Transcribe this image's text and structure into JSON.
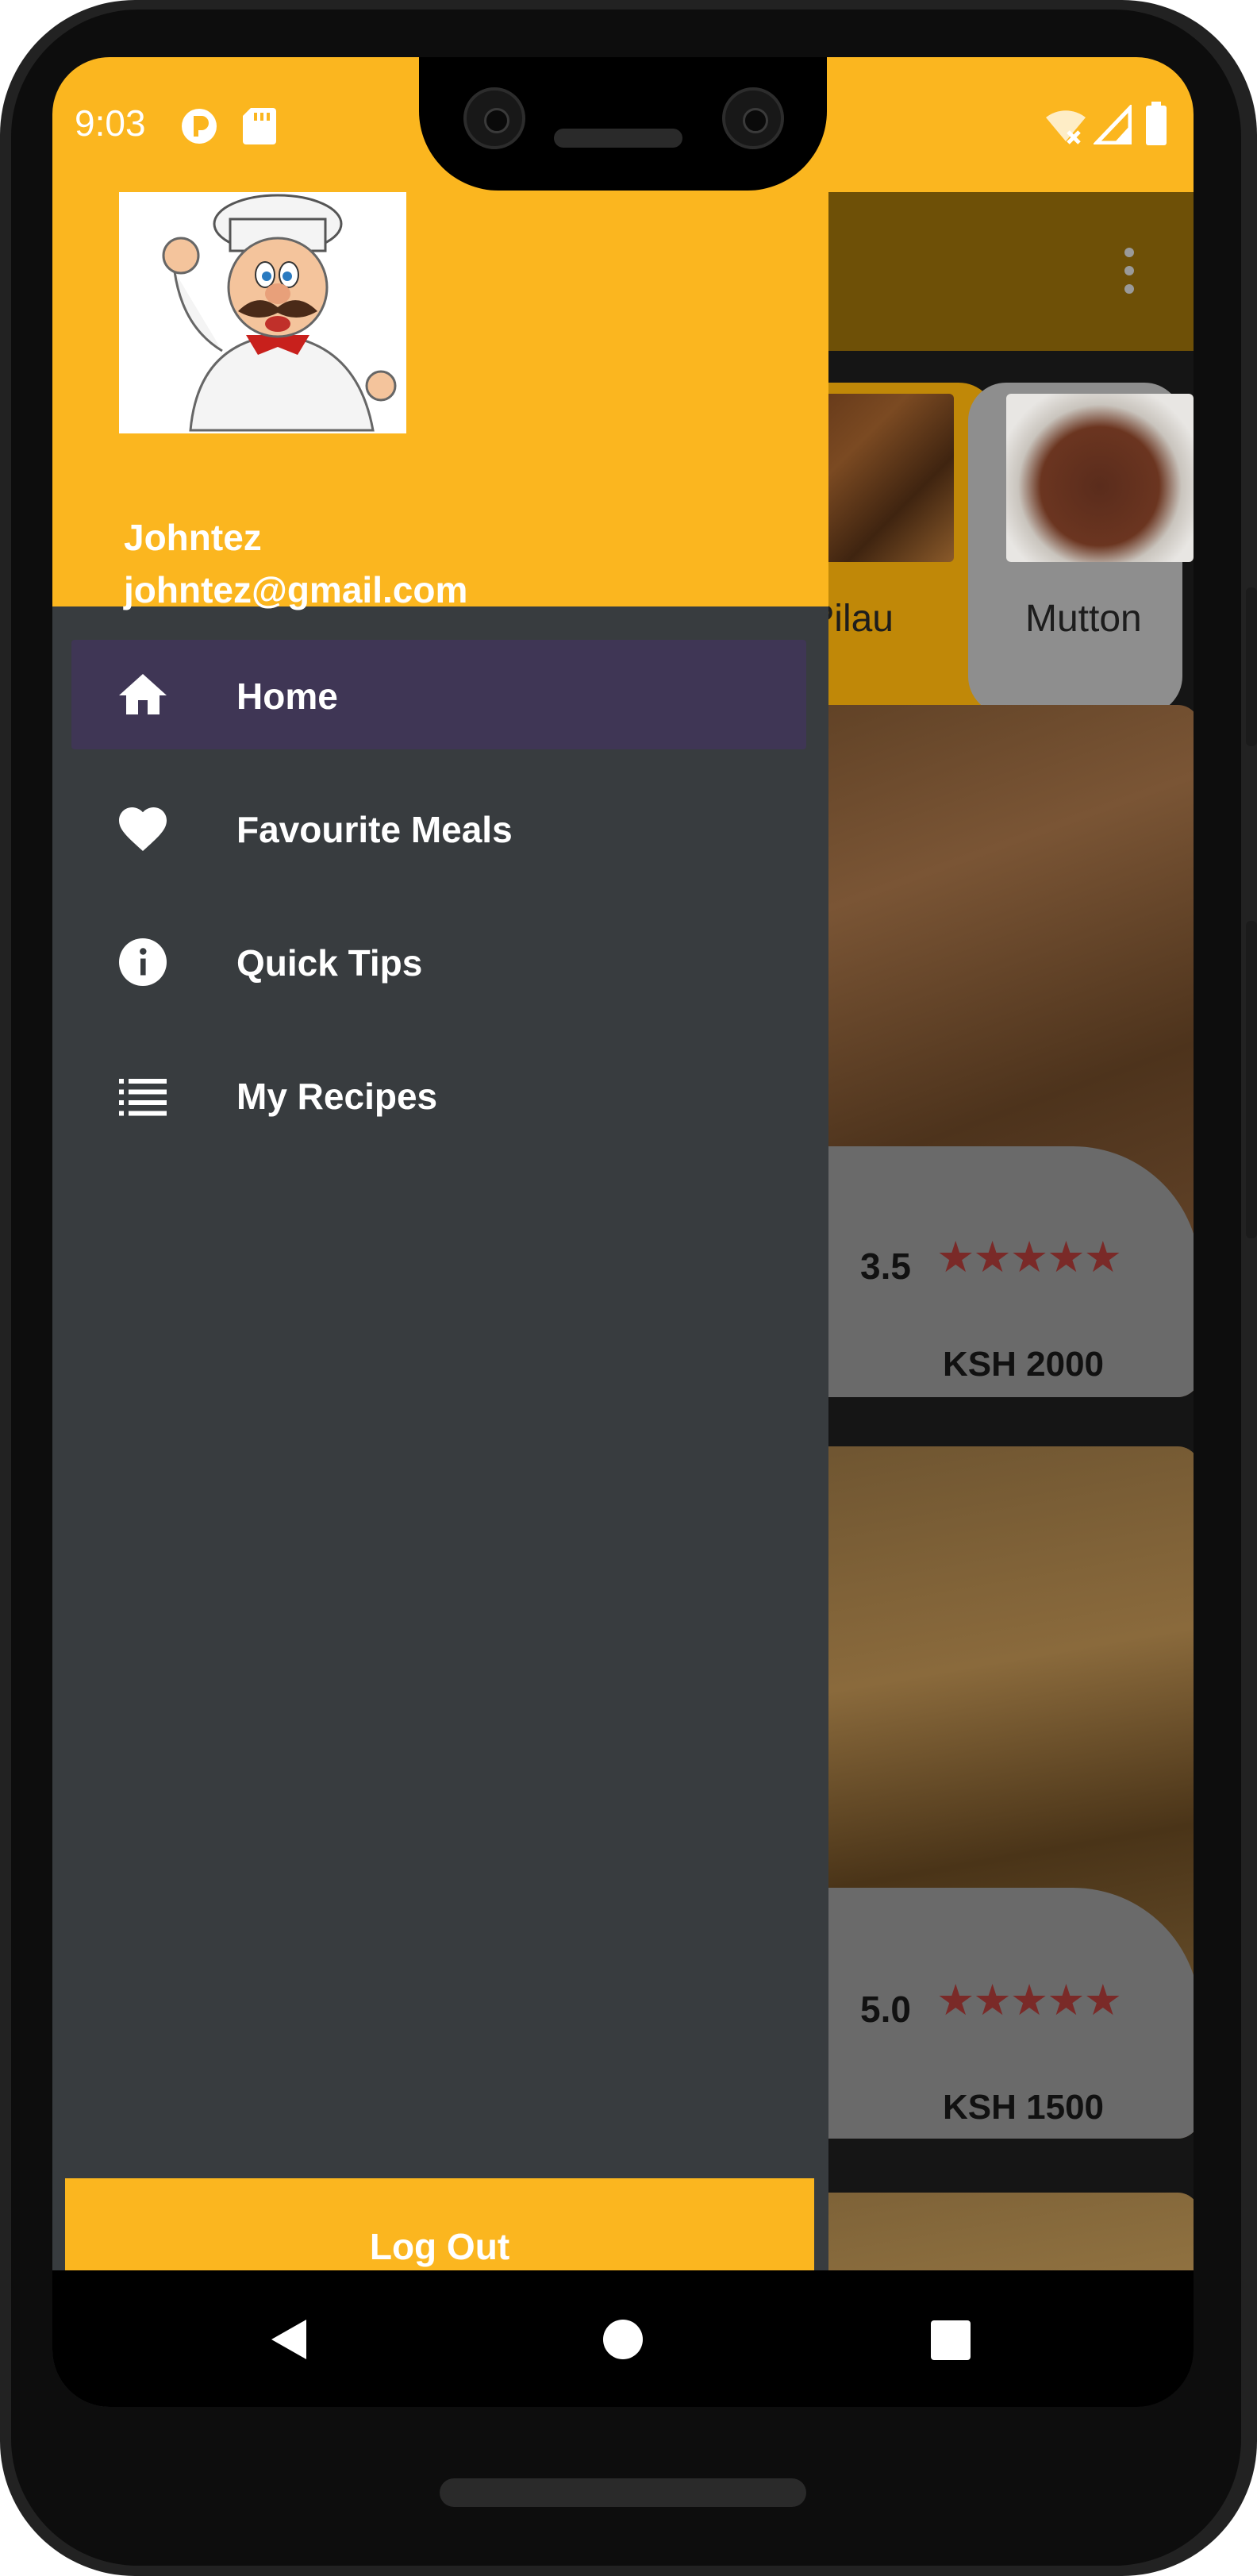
{
  "status_bar": {
    "time": "9:03"
  },
  "background": {
    "categories": [
      {
        "label": "Pilau"
      },
      {
        "label": "Mutton"
      }
    ],
    "meals": [
      {
        "rating": "3.5",
        "stars": "★★★★★",
        "price": "KSH 2000"
      },
      {
        "rating": "5.0",
        "stars": "★★★★★",
        "price": "KSH 1500"
      }
    ]
  },
  "drawer": {
    "user": {
      "name": "Johntez",
      "email": "johntez@gmail.com"
    },
    "items": [
      {
        "label": "Home",
        "icon": "home-icon",
        "active": true
      },
      {
        "label": "Favourite Meals",
        "icon": "heart-icon",
        "active": false
      },
      {
        "label": "Quick Tips",
        "icon": "info-icon",
        "active": false
      },
      {
        "label": "My Recipes",
        "icon": "list-icon",
        "active": false
      }
    ],
    "logout_label": "Log Out"
  },
  "colors": {
    "accent": "#fbb61f",
    "drawer_bg": "#383c3f",
    "active_item": "#3f3655",
    "star": "#7a2a28"
  }
}
